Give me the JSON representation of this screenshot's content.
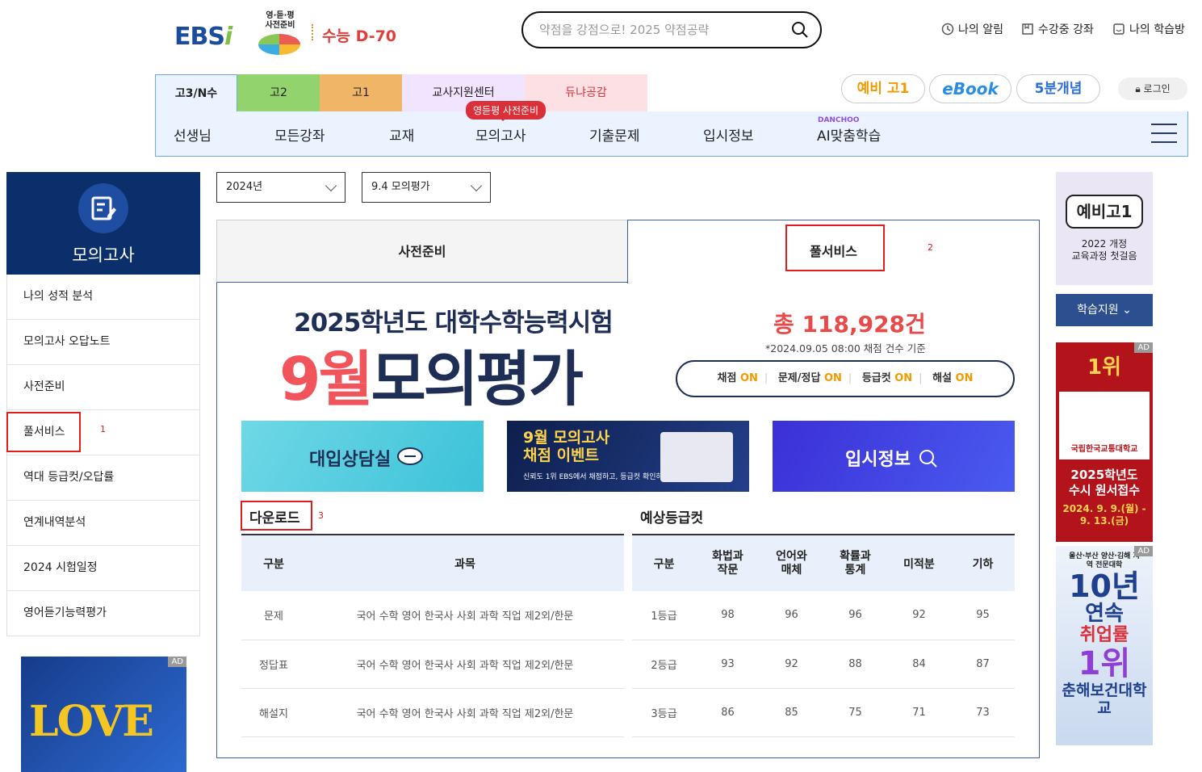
{
  "header": {
    "logo_text": "EBS",
    "logo_i": "i",
    "event_label_1": "영·듣·평",
    "event_label_2": "사전준비",
    "dday": "수능 D-70",
    "search_placeholder": "약점을 강점으로! 2025 약점공략",
    "util_links": [
      "나의 알림",
      "수강중 강좌",
      "나의 학습방"
    ]
  },
  "grade_tabs": [
    "고3/N수",
    "고2",
    "고1",
    "교사지원센터",
    "듀냐공감"
  ],
  "promo_pills": [
    "예비 고1",
    "eBook",
    "5분개념"
  ],
  "login_label": "로그인",
  "nav": {
    "items": [
      "선생님",
      "모든강좌",
      "교재",
      "모의고사",
      "기출문제",
      "입시정보",
      "AI맞춤학습"
    ],
    "mock_badge": "영듣평 사전준비",
    "ai_tag": "DANCHOO"
  },
  "sidebar": {
    "title": "모의고사",
    "items": [
      "나의 성적 분석",
      "모의고사 오답노트",
      "사전준비",
      "풀서비스",
      "역대 등급컷/오답률",
      "연계내역분석",
      "2024 시험일정",
      "영어듣기능력평가"
    ]
  },
  "selects": {
    "year": "2024년",
    "exam": "9.4 모의평가"
  },
  "tabs": {
    "prep": "사전준비",
    "full": "풀서비스"
  },
  "annotations": {
    "n1": "1",
    "n2": "2",
    "n3": "3"
  },
  "banner": {
    "subtitle": "2025학년도 대학수학능력시험",
    "title_red": "9월",
    "title_rest": "모의평가",
    "count": "총 118,928건",
    "count_note": "*2024.09.05 08:00 채점 건수 기준",
    "statuses": [
      {
        "label": "채점",
        "state": "ON"
      },
      {
        "label": "문제/정답",
        "state": "ON"
      },
      {
        "label": "등급컷",
        "state": "ON"
      },
      {
        "label": "해설",
        "state": "ON"
      }
    ]
  },
  "promo_banners": {
    "counsel": "대입상담실",
    "event_title_1": "9월 모의고사",
    "event_title_2": "채점 이벤트",
    "event_sub": "신뢰도 1위 EBS에서 채점하고, 등급컷 확인하자!",
    "admission": "입시정보"
  },
  "download": {
    "title": "다운로드",
    "headers": [
      "구분",
      "과목"
    ],
    "rows": [
      {
        "type": "문제",
        "subjects": "국어 수학 영어 한국사 사회 과학 직업 제2외/한문"
      },
      {
        "type": "정답표",
        "subjects": "국어 수학 영어 한국사 사회 과학 직업 제2외/한문"
      },
      {
        "type": "해설지",
        "subjects": "국어 수학 영어 한국사 사회 과학 직업 제2외/한문"
      }
    ]
  },
  "cutoff": {
    "title": "예상등급컷",
    "headers": [
      "구분",
      "화법과\n작문",
      "언어와\n매체",
      "확률과\n통계",
      "미적분",
      "기하"
    ],
    "rows": [
      [
        "1등급",
        "98",
        "96",
        "96",
        "92",
        "95"
      ],
      [
        "2등급",
        "93",
        "92",
        "88",
        "84",
        "87"
      ],
      [
        "3등급",
        "86",
        "85",
        "75",
        "71",
        "73"
      ]
    ]
  },
  "right_ads": {
    "ad1_bubble": "예비고1",
    "ad1_text_1": "2022 개정",
    "ad1_text_2": "교육과정 첫걸음",
    "learn_support": "학습지원",
    "ad_tag": "AD",
    "ad2_rank": "1위",
    "ad2_school": "국립한국교통대학교",
    "ad2_line1": "2025학년도",
    "ad2_line2": "수시 원서접수",
    "ad2_date": "2024. 9. 9.(월) - 9. 13.(금)",
    "ad3_region": "울산·부산 양산·김해 지역 전문대학",
    "ad3_years": "10년",
    "ad3_cont": "연속",
    "ad3_job": "취업률",
    "ad3_rank": "1위",
    "ad3_school": "춘해보건대학교"
  },
  "left_ad": {
    "love": "LOVE",
    "tag": "AD"
  }
}
